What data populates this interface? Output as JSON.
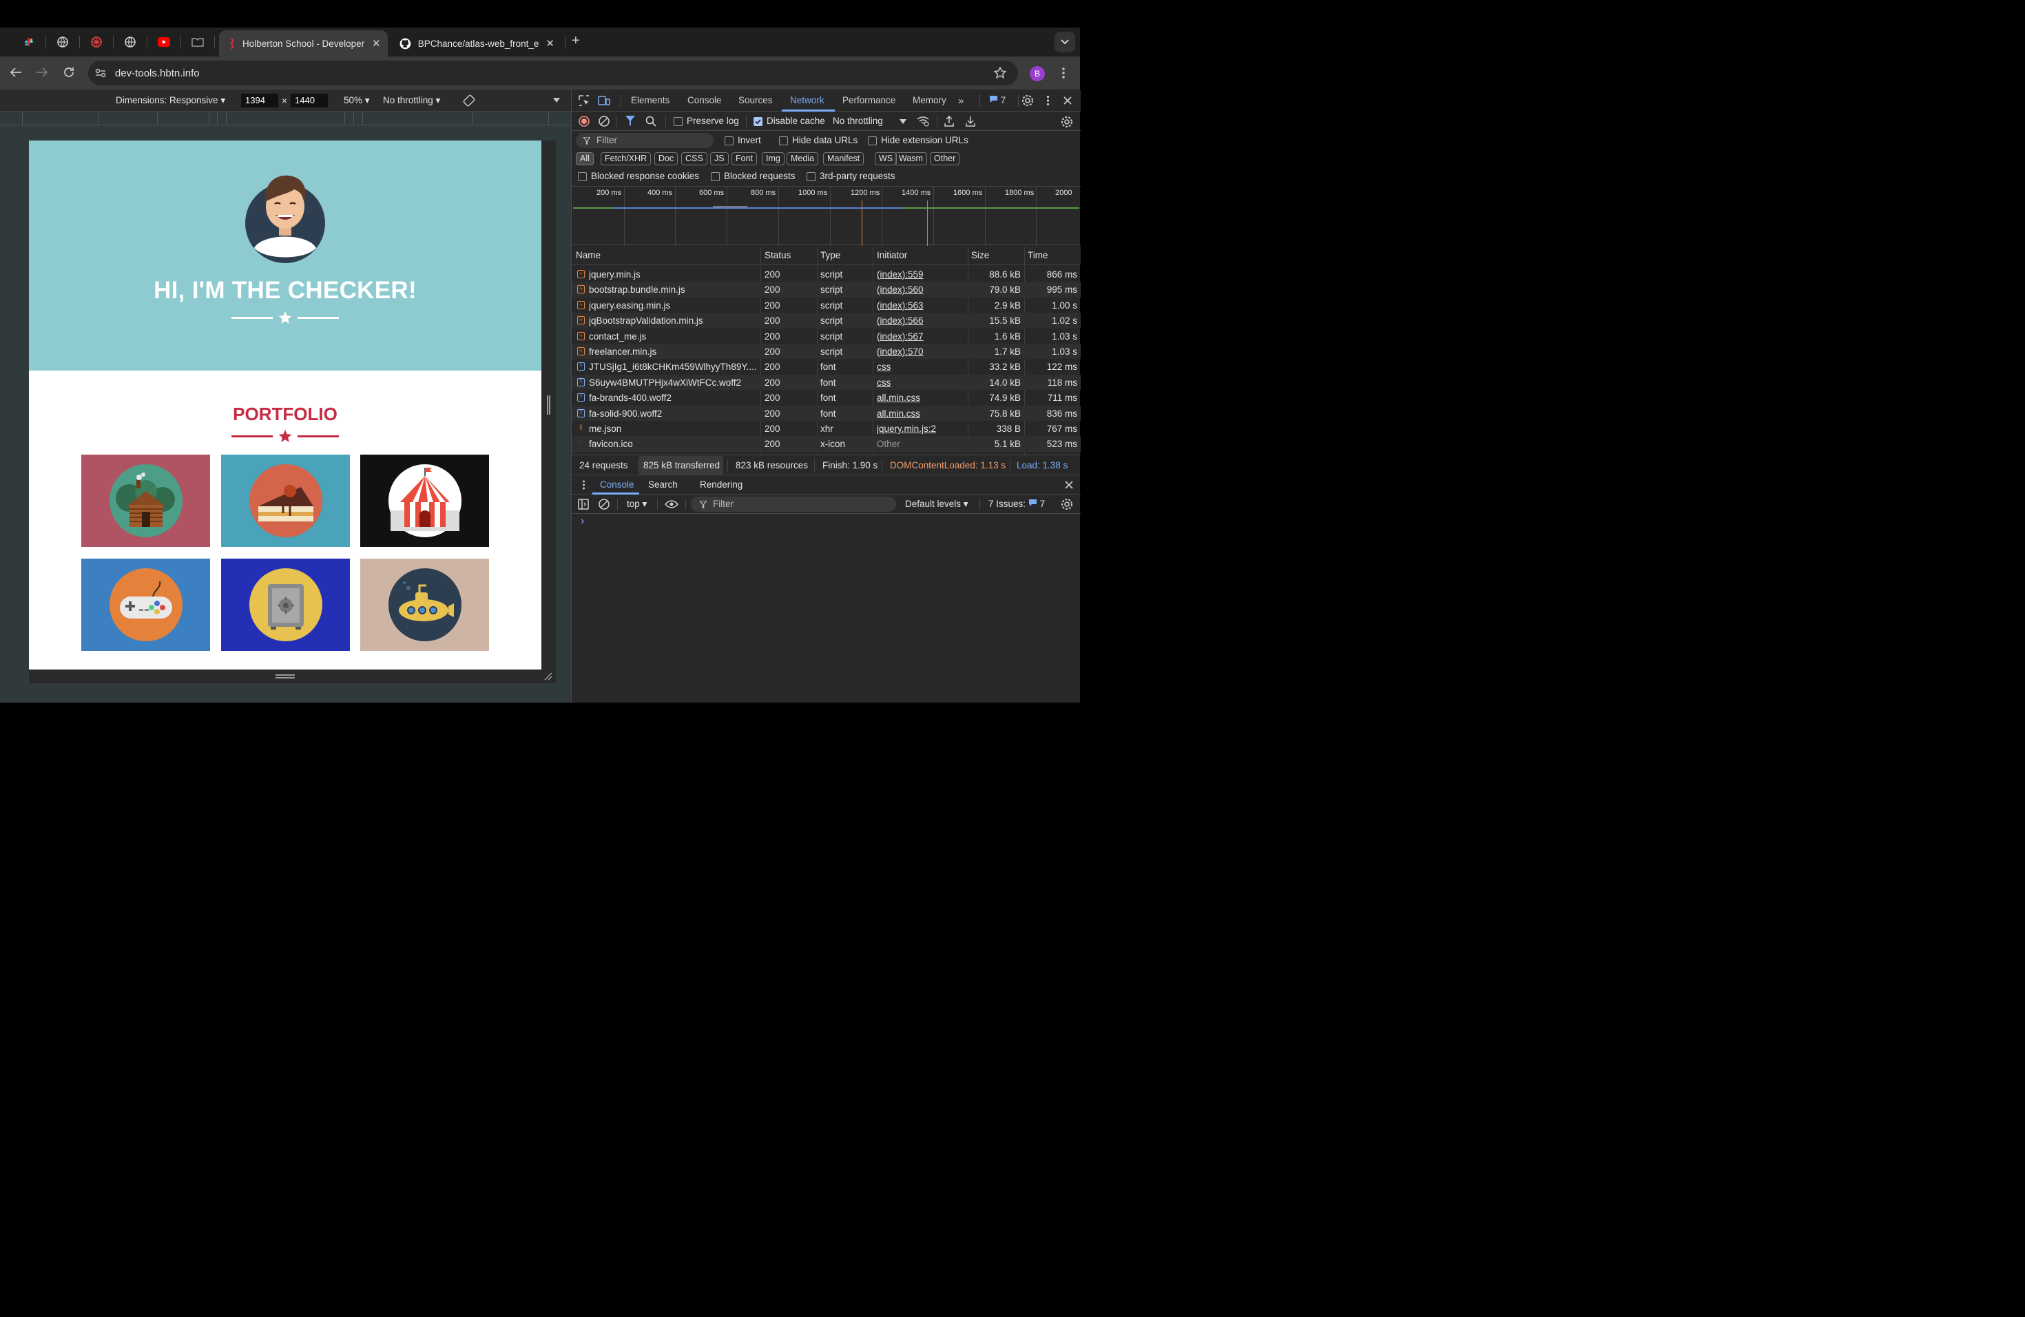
{
  "browser": {
    "tabs": [
      {
        "title": "Holberton School - Developer",
        "close": "✕"
      },
      {
        "title": "BPChance/atlas-web_front_e",
        "close": "✕"
      }
    ],
    "new_tab": "+",
    "url": "dev-tools.hbtn.info",
    "profile_initial": "B"
  },
  "device_toolbar": {
    "dimensions_label": "Dimensions: Responsive",
    "width": "1394",
    "times": "×",
    "height": "1440",
    "zoom": "50%",
    "throttling": "No throttling"
  },
  "page": {
    "hero_title": "HI, I'M THE CHECKER!",
    "portfolio_title": "PORTFOLIO",
    "colors": {
      "hero_bg": "#8ecbd0",
      "accent": "#c62b43"
    },
    "cards": [
      {
        "icon": "log-cabin-icon",
        "bg": "#b05363"
      },
      {
        "icon": "cake-slice-icon",
        "bg": "#4aa3b8"
      },
      {
        "icon": "circus-tent-icon",
        "bg": "#111111"
      },
      {
        "icon": "game-controller-icon",
        "bg": "#3d80c1"
      },
      {
        "icon": "safe-icon",
        "bg": "#2330b6"
      },
      {
        "icon": "submarine-icon",
        "bg": "#cdb4a5"
      }
    ]
  },
  "devtools": {
    "tabs": [
      "Elements",
      "Console",
      "Sources",
      "Network",
      "Performance",
      "Memory"
    ],
    "active_tab": "Network",
    "issues_count": "7",
    "network_toolbar": {
      "preserve_log": "Preserve log",
      "disable_cache": "Disable cache",
      "throttling": "No throttling"
    },
    "filter": {
      "placeholder": "Filter",
      "invert": "Invert",
      "hide_data_urls": "Hide data URLs",
      "hide_extension_urls": "Hide extension URLs"
    },
    "type_filters": [
      "All",
      "Fetch/XHR",
      "Doc",
      "CSS",
      "JS",
      "Font",
      "Img",
      "Media",
      "Manifest",
      "WS",
      "Wasm",
      "Other"
    ],
    "blocked": {
      "response_cookies": "Blocked response cookies",
      "requests": "Blocked requests",
      "third_party": "3rd-party requests"
    },
    "timeline_labels": [
      "200 ms",
      "400 ms",
      "600 ms",
      "800 ms",
      "1000 ms",
      "1200 ms",
      "1400 ms",
      "1600 ms",
      "1800 ms",
      "2000"
    ],
    "columns": [
      "Name",
      "Status",
      "Type",
      "Initiator",
      "Size",
      "Time"
    ],
    "requests": [
      {
        "name": "jquery.min.js",
        "status": "200",
        "type": "script",
        "initiator": "(index):559",
        "size": "88.6 kB",
        "time": "866 ms",
        "kind": "script"
      },
      {
        "name": "bootstrap.bundle.min.js",
        "status": "200",
        "type": "script",
        "initiator": "(index):560",
        "size": "79.0 kB",
        "time": "995 ms",
        "kind": "script"
      },
      {
        "name": "jquery.easing.min.js",
        "status": "200",
        "type": "script",
        "initiator": "(index):563",
        "size": "2.9 kB",
        "time": "1.00 s",
        "kind": "script"
      },
      {
        "name": "jqBootstrapValidation.min.js",
        "status": "200",
        "type": "script",
        "initiator": "(index):566",
        "size": "15.5 kB",
        "time": "1.02 s",
        "kind": "script"
      },
      {
        "name": "contact_me.js",
        "status": "200",
        "type": "script",
        "initiator": "(index):567",
        "size": "1.6 kB",
        "time": "1.03 s",
        "kind": "script"
      },
      {
        "name": "freelancer.min.js",
        "status": "200",
        "type": "script",
        "initiator": "(index):570",
        "size": "1.7 kB",
        "time": "1.03 s",
        "kind": "script"
      },
      {
        "name": "JTUSjIg1_i6t8kCHKm459WlhyyTh89Y....",
        "status": "200",
        "type": "font",
        "initiator": "css",
        "size": "33.2 kB",
        "time": "122 ms",
        "kind": "font"
      },
      {
        "name": "S6uyw4BMUTPHjx4wXiWtFCc.woff2",
        "status": "200",
        "type": "font",
        "initiator": "css",
        "size": "14.0 kB",
        "time": "118 ms",
        "kind": "font"
      },
      {
        "name": "fa-brands-400.woff2",
        "status": "200",
        "type": "font",
        "initiator": "all.min.css",
        "size": "74.9 kB",
        "time": "711 ms",
        "kind": "font"
      },
      {
        "name": "fa-solid-900.woff2",
        "status": "200",
        "type": "font",
        "initiator": "all.min.css",
        "size": "75.8 kB",
        "time": "836 ms",
        "kind": "font"
      },
      {
        "name": "me.json",
        "status": "200",
        "type": "xhr",
        "initiator": "jquery.min.js:2",
        "size": "338 B",
        "time": "767 ms",
        "kind": "xhr"
      },
      {
        "name": "favicon.ico",
        "status": "200",
        "type": "x-icon",
        "initiator": "Other",
        "size": "5.1 kB",
        "time": "523 ms",
        "kind": "icon"
      }
    ],
    "summary": {
      "requests": "24 requests",
      "transferred": "825 kB transferred",
      "resources": "823 kB resources",
      "finish": "Finish: 1.90 s",
      "dom_content_loaded": "DOMContentLoaded: 1.13 s",
      "load": "Load: 1.38 s"
    },
    "drawer": {
      "tabs": [
        "Console",
        "Search",
        "Rendering"
      ],
      "context": "top",
      "filter_placeholder": "Filter",
      "levels": "Default levels",
      "issues_label": "7 Issues:",
      "issues_count": "7",
      "prompt": "›"
    }
  }
}
